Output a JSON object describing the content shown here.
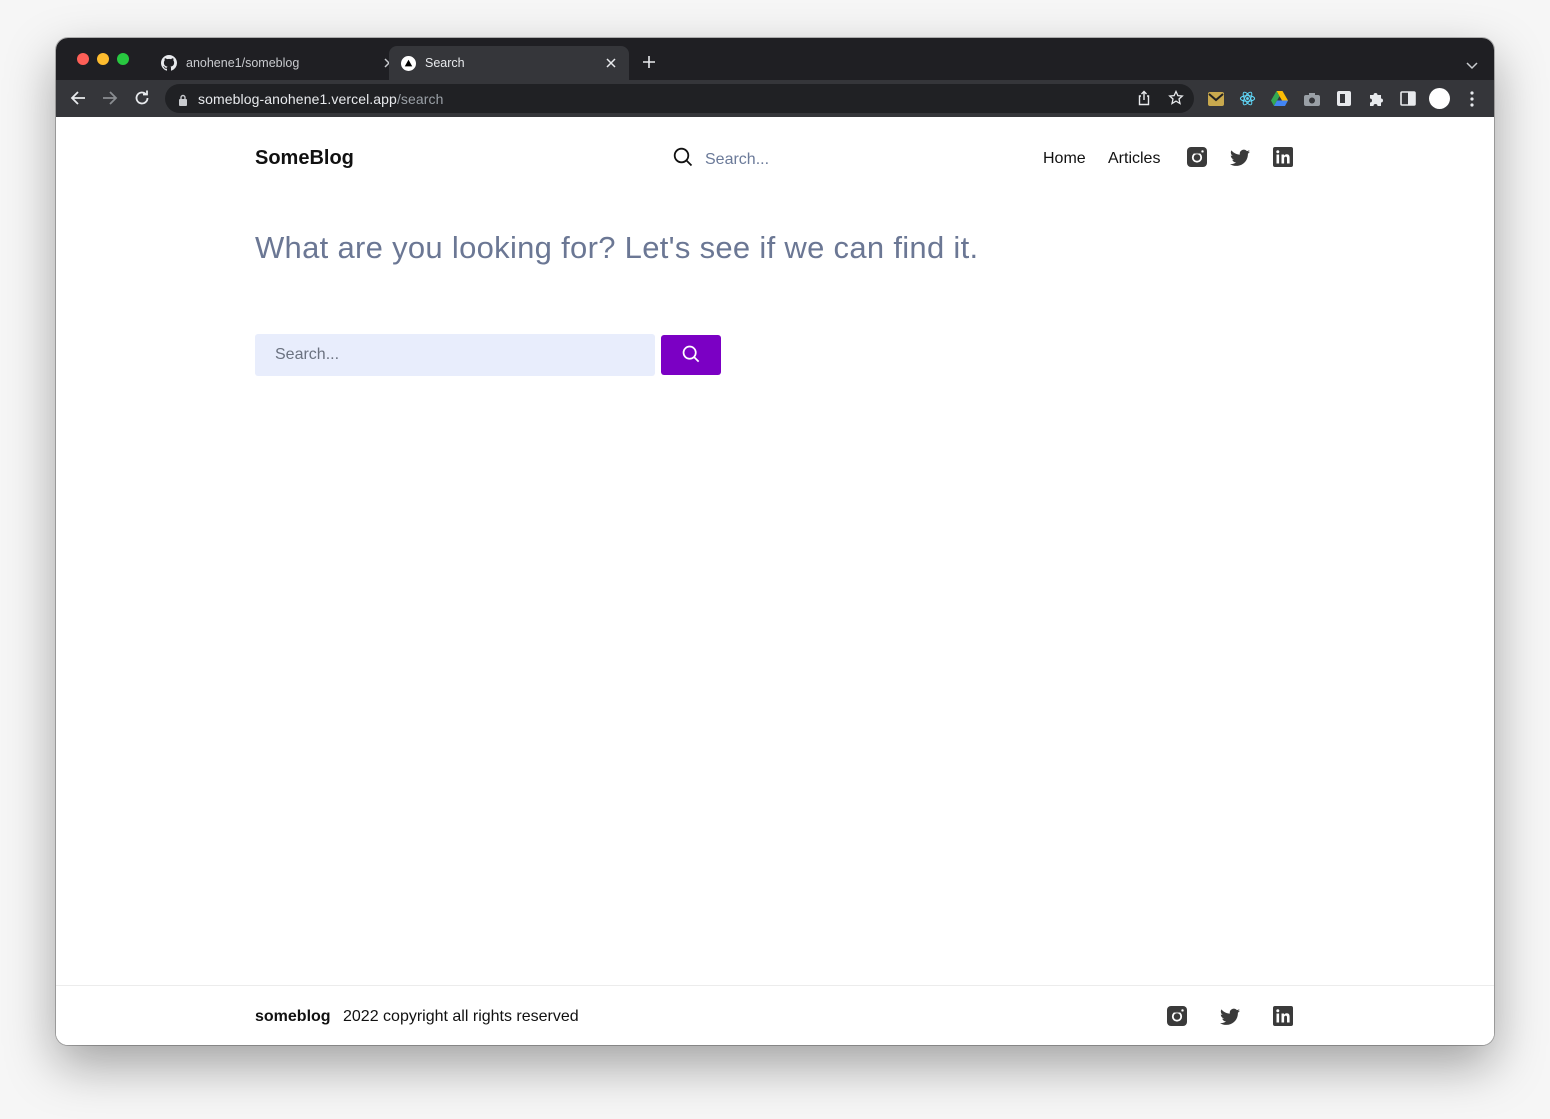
{
  "browser": {
    "tabs": [
      {
        "title": "anohene1/someblog",
        "icon": "github-icon",
        "active": false
      },
      {
        "title": "Search",
        "icon": "vercel-icon",
        "active": true
      }
    ],
    "url_host": "someblog-anohene1.vercel.app",
    "url_path": "/search"
  },
  "header": {
    "logo": "SomeBlog",
    "search_placeholder": "Search...",
    "nav": [
      {
        "label": "Home"
      },
      {
        "label": "Articles"
      }
    ],
    "social_icons": [
      "instagram-icon",
      "twitter-icon",
      "linkedin-icon"
    ]
  },
  "main": {
    "headline": "What are you looking for? Let's see if we can find it.",
    "search_placeholder": "Search...",
    "search_button_color": "#7b00c4"
  },
  "footer": {
    "brand": "someblog",
    "copyright": "2022 copyright all rights reserved",
    "social_icons": [
      "instagram-icon",
      "twitter-icon",
      "linkedin-icon"
    ]
  }
}
